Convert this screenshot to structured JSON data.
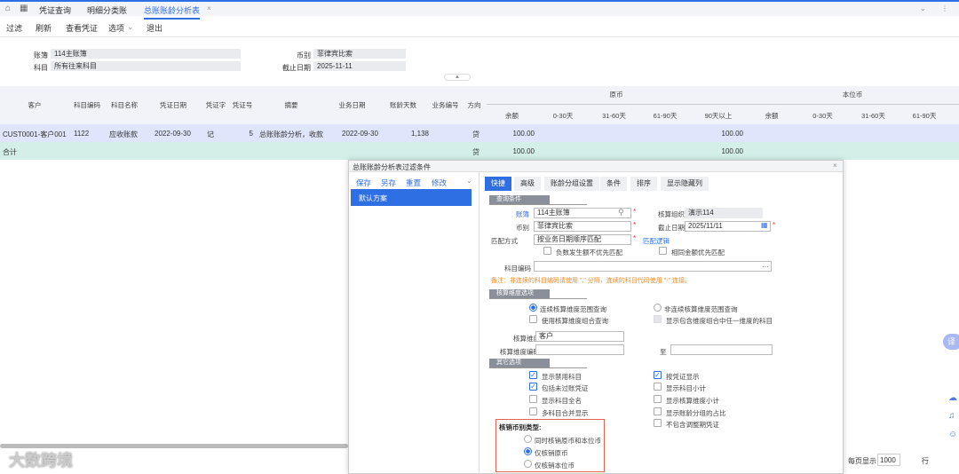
{
  "tabs": [
    "凭证查询",
    "明细分类账",
    "总账账龄分析表"
  ],
  "toolbar": [
    "过滤",
    "刷新",
    "查看凭证",
    "选项",
    "退出"
  ],
  "info": {
    "book_label": "账簿",
    "book": "114主账簿",
    "subject_label": "科目",
    "subject": "所有往来科目",
    "currency_label": "币别",
    "currency": "菲律宾比索",
    "enddate_label": "截止日期",
    "enddate": "2025-11-11"
  },
  "table": {
    "columns": [
      "客户",
      "科目编码",
      "科目名称",
      "凭证日期",
      "凭证字",
      "凭证号",
      "摘要",
      "业务日期",
      "账龄天数",
      "业务编号",
      "方向"
    ],
    "group_orig": "原币",
    "group_local": "本位币",
    "orig_cols": [
      "余额",
      "0-30天",
      "31-60天",
      "61-90天",
      "90天以上"
    ],
    "local_cols": [
      "余额",
      "0-30天",
      "31-60天",
      "61-90天"
    ],
    "row": {
      "customer": "CUST0001-客户001",
      "code": "1122",
      "name": "应收账款",
      "vdate": "2022-09-30",
      "vword": "记",
      "vno": "5",
      "summary": "总账账龄分析，收款",
      "bdate": "2022-09-30",
      "days": "1,138",
      "dir": "贷",
      "balance": "100.00",
      "over90": "100.00"
    },
    "total": {
      "label": "合计",
      "dir": "贷",
      "balance": "100.00",
      "over90": "100.00"
    }
  },
  "dialog": {
    "title": "总账账龄分析表过滤条件",
    "actions": [
      "保存",
      "另存",
      "重置",
      "修改"
    ],
    "scheme": "默认方案",
    "tabs": [
      "快捷",
      "高级",
      "账龄分组设置",
      "条件",
      "排序",
      "显示隐藏列"
    ],
    "sec_query": "查询条件",
    "book_label": "账簿",
    "book": "114主账簿",
    "org_label": "核算组织",
    "org": "演示114",
    "cur_label": "币别",
    "cur": "菲律宾比索",
    "end_label": "截止日期",
    "end": "2025/11/11",
    "match_label": "匹配方式",
    "match": "按业务日期顺序匹配",
    "match_logic": "匹配逻辑",
    "neg_first": "负数发生额不优先匹配",
    "same_first": "相同金额优先匹配",
    "code_label": "科目编码",
    "note": "备注：非连续的科目编码请使用 \",\" 分隔，连续的科目代码使用 \"-\" 连接。",
    "sec_dim": "核算维度选项",
    "dim_cont": "连续核算维度范围查询",
    "dim_noncont": "非连续核算维度范围查询",
    "dim_combo": "使用核算维度组合查询",
    "dim_any": "显示包含维度组合中任一维度的科目",
    "dim_label": "核算维度",
    "dim": "客户",
    "dimcode_label": "核算维度编码",
    "to": "至",
    "sec_other": "其它选项",
    "opts_left": [
      "显示禁用科目",
      "包括未过账凭证",
      "显示科目全名",
      "多科目合并显示"
    ],
    "opts_right": [
      "按凭证显示",
      "显示科目小计",
      "显示核算维度小计",
      "显示账龄分组的占比",
      "不包含调整期凭证"
    ],
    "wo_title": "核销币别类型:",
    "wo_opts": [
      "同时核销原币和本位币",
      "仅核销原币",
      "仅核销本位币"
    ]
  },
  "footer": {
    "perpage": "每页显示",
    "count": "1000",
    "unit": "行"
  },
  "watermark": "大数跨境",
  "translate": "译"
}
